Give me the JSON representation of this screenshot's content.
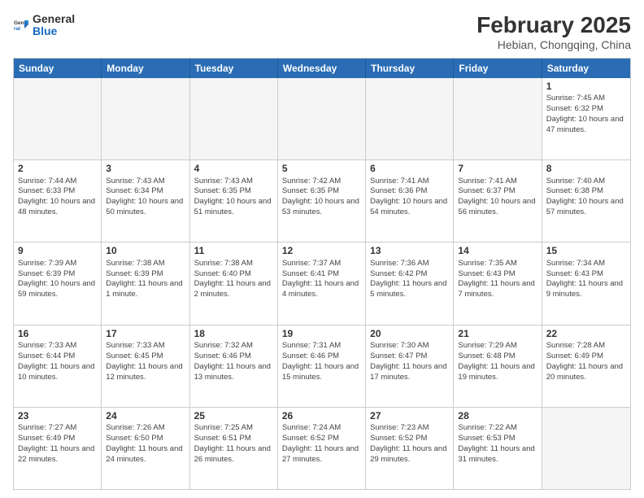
{
  "header": {
    "logo_general": "General",
    "logo_blue": "Blue",
    "month_title": "February 2025",
    "location": "Hebian, Chongqing, China"
  },
  "day_headers": [
    "Sunday",
    "Monday",
    "Tuesday",
    "Wednesday",
    "Thursday",
    "Friday",
    "Saturday"
  ],
  "weeks": [
    [
      {
        "day": "",
        "info": "",
        "empty": true
      },
      {
        "day": "",
        "info": "",
        "empty": true
      },
      {
        "day": "",
        "info": "",
        "empty": true
      },
      {
        "day": "",
        "info": "",
        "empty": true
      },
      {
        "day": "",
        "info": "",
        "empty": true
      },
      {
        "day": "",
        "info": "",
        "empty": true
      },
      {
        "day": "1",
        "info": "Sunrise: 7:45 AM\nSunset: 6:32 PM\nDaylight: 10 hours and 47 minutes.",
        "empty": false
      }
    ],
    [
      {
        "day": "2",
        "info": "Sunrise: 7:44 AM\nSunset: 6:33 PM\nDaylight: 10 hours and 48 minutes.",
        "empty": false
      },
      {
        "day": "3",
        "info": "Sunrise: 7:43 AM\nSunset: 6:34 PM\nDaylight: 10 hours and 50 minutes.",
        "empty": false
      },
      {
        "day": "4",
        "info": "Sunrise: 7:43 AM\nSunset: 6:35 PM\nDaylight: 10 hours and 51 minutes.",
        "empty": false
      },
      {
        "day": "5",
        "info": "Sunrise: 7:42 AM\nSunset: 6:35 PM\nDaylight: 10 hours and 53 minutes.",
        "empty": false
      },
      {
        "day": "6",
        "info": "Sunrise: 7:41 AM\nSunset: 6:36 PM\nDaylight: 10 hours and 54 minutes.",
        "empty": false
      },
      {
        "day": "7",
        "info": "Sunrise: 7:41 AM\nSunset: 6:37 PM\nDaylight: 10 hours and 56 minutes.",
        "empty": false
      },
      {
        "day": "8",
        "info": "Sunrise: 7:40 AM\nSunset: 6:38 PM\nDaylight: 10 hours and 57 minutes.",
        "empty": false
      }
    ],
    [
      {
        "day": "9",
        "info": "Sunrise: 7:39 AM\nSunset: 6:39 PM\nDaylight: 10 hours and 59 minutes.",
        "empty": false
      },
      {
        "day": "10",
        "info": "Sunrise: 7:38 AM\nSunset: 6:39 PM\nDaylight: 11 hours and 1 minute.",
        "empty": false
      },
      {
        "day": "11",
        "info": "Sunrise: 7:38 AM\nSunset: 6:40 PM\nDaylight: 11 hours and 2 minutes.",
        "empty": false
      },
      {
        "day": "12",
        "info": "Sunrise: 7:37 AM\nSunset: 6:41 PM\nDaylight: 11 hours and 4 minutes.",
        "empty": false
      },
      {
        "day": "13",
        "info": "Sunrise: 7:36 AM\nSunset: 6:42 PM\nDaylight: 11 hours and 5 minutes.",
        "empty": false
      },
      {
        "day": "14",
        "info": "Sunrise: 7:35 AM\nSunset: 6:43 PM\nDaylight: 11 hours and 7 minutes.",
        "empty": false
      },
      {
        "day": "15",
        "info": "Sunrise: 7:34 AM\nSunset: 6:43 PM\nDaylight: 11 hours and 9 minutes.",
        "empty": false
      }
    ],
    [
      {
        "day": "16",
        "info": "Sunrise: 7:33 AM\nSunset: 6:44 PM\nDaylight: 11 hours and 10 minutes.",
        "empty": false
      },
      {
        "day": "17",
        "info": "Sunrise: 7:33 AM\nSunset: 6:45 PM\nDaylight: 11 hours and 12 minutes.",
        "empty": false
      },
      {
        "day": "18",
        "info": "Sunrise: 7:32 AM\nSunset: 6:46 PM\nDaylight: 11 hours and 13 minutes.",
        "empty": false
      },
      {
        "day": "19",
        "info": "Sunrise: 7:31 AM\nSunset: 6:46 PM\nDaylight: 11 hours and 15 minutes.",
        "empty": false
      },
      {
        "day": "20",
        "info": "Sunrise: 7:30 AM\nSunset: 6:47 PM\nDaylight: 11 hours and 17 minutes.",
        "empty": false
      },
      {
        "day": "21",
        "info": "Sunrise: 7:29 AM\nSunset: 6:48 PM\nDaylight: 11 hours and 19 minutes.",
        "empty": false
      },
      {
        "day": "22",
        "info": "Sunrise: 7:28 AM\nSunset: 6:49 PM\nDaylight: 11 hours and 20 minutes.",
        "empty": false
      }
    ],
    [
      {
        "day": "23",
        "info": "Sunrise: 7:27 AM\nSunset: 6:49 PM\nDaylight: 11 hours and 22 minutes.",
        "empty": false
      },
      {
        "day": "24",
        "info": "Sunrise: 7:26 AM\nSunset: 6:50 PM\nDaylight: 11 hours and 24 minutes.",
        "empty": false
      },
      {
        "day": "25",
        "info": "Sunrise: 7:25 AM\nSunset: 6:51 PM\nDaylight: 11 hours and 26 minutes.",
        "empty": false
      },
      {
        "day": "26",
        "info": "Sunrise: 7:24 AM\nSunset: 6:52 PM\nDaylight: 11 hours and 27 minutes.",
        "empty": false
      },
      {
        "day": "27",
        "info": "Sunrise: 7:23 AM\nSunset: 6:52 PM\nDaylight: 11 hours and 29 minutes.",
        "empty": false
      },
      {
        "day": "28",
        "info": "Sunrise: 7:22 AM\nSunset: 6:53 PM\nDaylight: 11 hours and 31 minutes.",
        "empty": false
      },
      {
        "day": "",
        "info": "",
        "empty": true
      }
    ]
  ]
}
